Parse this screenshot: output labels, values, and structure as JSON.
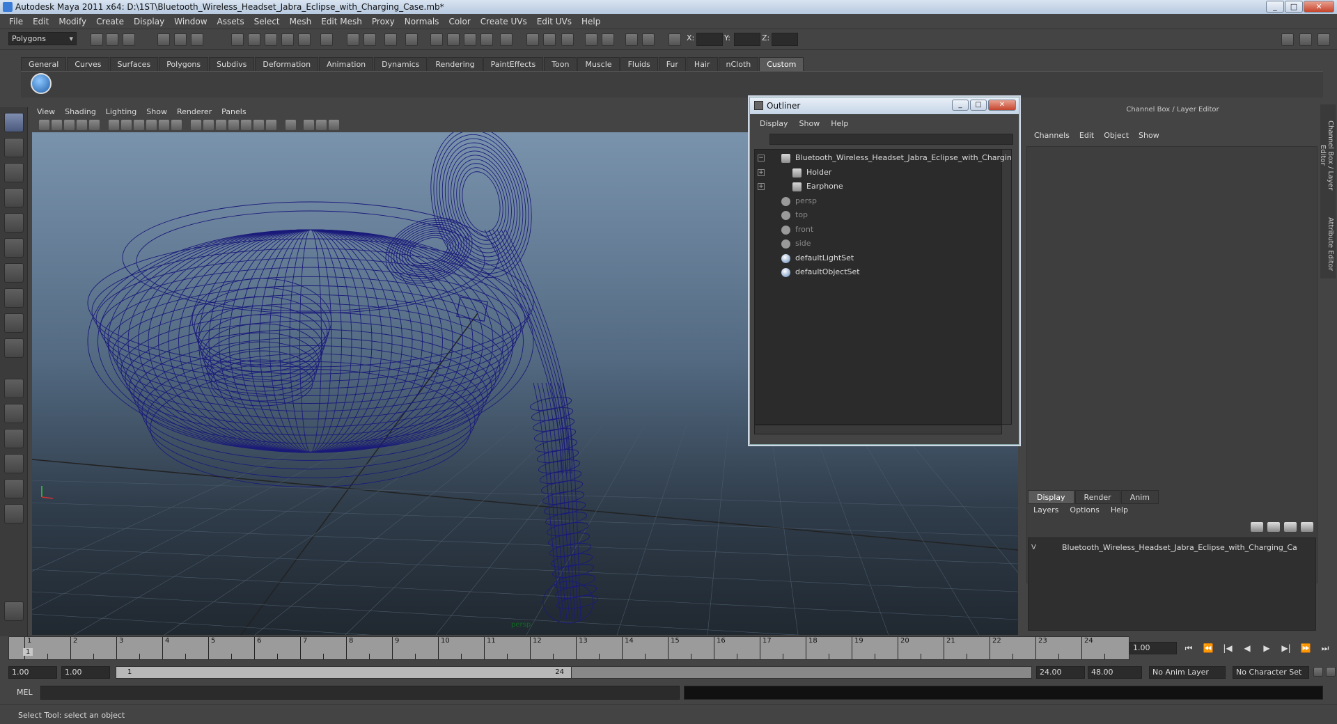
{
  "window": {
    "title": "Autodesk Maya 2011 x64: D:\\1ST\\Bluetooth_Wireless_Headset_Jabra_Eclipse_with_Charging_Case.mb*"
  },
  "menubar": [
    "File",
    "Edit",
    "Modify",
    "Create",
    "Display",
    "Window",
    "Assets",
    "Select",
    "Mesh",
    "Edit Mesh",
    "Proxy",
    "Normals",
    "Color",
    "Create UVs",
    "Edit UVs",
    "Help"
  ],
  "status": {
    "mode": "Polygons",
    "x_label": "X:",
    "y_label": "Y:",
    "z_label": "Z:"
  },
  "shelf": {
    "tabs": [
      "General",
      "Curves",
      "Surfaces",
      "Polygons",
      "Subdivs",
      "Deformation",
      "Animation",
      "Dynamics",
      "Rendering",
      "PaintEffects",
      "Toon",
      "Muscle",
      "Fluids",
      "Fur",
      "Hair",
      "nCloth",
      "Custom"
    ],
    "active": "Custom"
  },
  "viewport": {
    "menu": [
      "View",
      "Shading",
      "Lighting",
      "Show",
      "Renderer",
      "Panels"
    ],
    "camera_label": "persp",
    "wire_color": "#1a1a7a"
  },
  "outliner": {
    "title": "Outliner",
    "menu": [
      "Display",
      "Show",
      "Help"
    ],
    "items": [
      {
        "label": "Bluetooth_Wireless_Headset_Jabra_Eclipse_with_Charging",
        "icon": "mesh-group-icon",
        "expand": "−",
        "dim": false
      },
      {
        "label": "Holder",
        "icon": "mesh-group-icon",
        "expand": "+",
        "dim": false
      },
      {
        "label": "Earphone",
        "icon": "mesh-group-icon",
        "expand": "+",
        "dim": false
      },
      {
        "label": "persp",
        "icon": "camera-icon",
        "expand": "",
        "dim": true
      },
      {
        "label": "top",
        "icon": "camera-icon",
        "expand": "",
        "dim": true
      },
      {
        "label": "front",
        "icon": "camera-icon",
        "expand": "",
        "dim": true
      },
      {
        "label": "side",
        "icon": "camera-icon",
        "expand": "",
        "dim": true
      },
      {
        "label": "defaultLightSet",
        "icon": "set-icon",
        "expand": "",
        "dim": false
      },
      {
        "label": "defaultObjectSet",
        "icon": "set-icon",
        "expand": "",
        "dim": false
      }
    ]
  },
  "channelbox": {
    "title": "Channel Box / Layer Editor",
    "menu": [
      "Channels",
      "Edit",
      "Object",
      "Show"
    ],
    "side_tabs": [
      "Channel Box / Layer Editor",
      "Attribute Editor"
    ],
    "layer_tabs": [
      "Display",
      "Render",
      "Anim"
    ],
    "layer_active": "Display",
    "layer_menu": [
      "Layers",
      "Options",
      "Help"
    ],
    "layer_visible": "V",
    "layer_name": "Bluetooth_Wireless_Headset_Jabra_Eclipse_with_Charging_Ca"
  },
  "timeline": {
    "ticks": [
      "1",
      "2",
      "3",
      "4",
      "5",
      "6",
      "7",
      "8",
      "9",
      "10",
      "11",
      "12",
      "13",
      "14",
      "15",
      "16",
      "17",
      "18",
      "19",
      "20",
      "21",
      "22",
      "23",
      "24"
    ],
    "current_marker": "1",
    "current_frame": "1.00"
  },
  "range": {
    "start": "1.00",
    "playback_start": "1.00",
    "slider_start": "1",
    "slider_end": "24",
    "playback_end": "24.00",
    "end": "48.00",
    "anim_layer": "No Anim Layer",
    "char_set": "No Character Set"
  },
  "command": {
    "label": "MEL"
  },
  "help": {
    "text": "Select Tool: select an object"
  }
}
